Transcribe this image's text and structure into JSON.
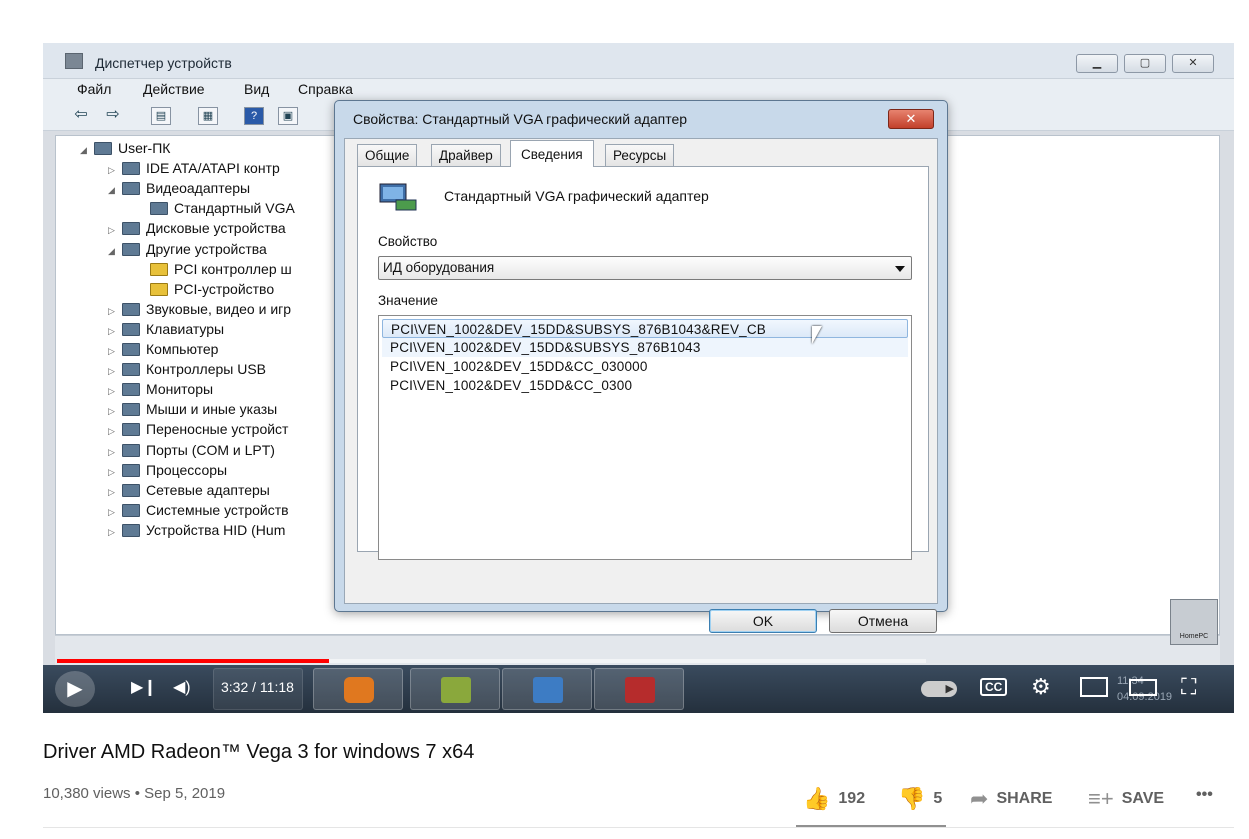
{
  "device_manager": {
    "title": "Диспетчер устройств",
    "menu": [
      "Файл",
      "Действие",
      "Вид",
      "Справка"
    ],
    "tree": [
      {
        "label": "User-ПК",
        "level": 0,
        "expanded": true,
        "icon": "computer-icon"
      },
      {
        "label": "IDE ATA/ATAPI контр",
        "level": 1,
        "expanded": false,
        "icon": "ide-controller-icon"
      },
      {
        "label": "Видеоадаптеры",
        "level": 1,
        "expanded": true,
        "icon": "display-adapter-icon"
      },
      {
        "label": "Стандартный VGA",
        "level": 2,
        "icon": "display-adapter-icon"
      },
      {
        "label": "Дисковые устройства",
        "level": 1,
        "expanded": false,
        "icon": "disk-icon"
      },
      {
        "label": "Другие устройства",
        "level": 1,
        "expanded": true,
        "icon": "unknown-device-icon"
      },
      {
        "label": "PCI контроллер ш",
        "level": 2,
        "icon": "warning-device-icon"
      },
      {
        "label": "PCI-устройство",
        "level": 2,
        "icon": "warning-device-icon"
      },
      {
        "label": "Звуковые, видео и игр",
        "level": 1,
        "expanded": false,
        "icon": "sound-icon"
      },
      {
        "label": "Клавиатуры",
        "level": 1,
        "expanded": false,
        "icon": "keyboard-icon"
      },
      {
        "label": "Компьютер",
        "level": 1,
        "expanded": false,
        "icon": "computer-icon"
      },
      {
        "label": "Контроллеры USB",
        "level": 1,
        "expanded": false,
        "icon": "usb-icon"
      },
      {
        "label": "Мониторы",
        "level": 1,
        "expanded": false,
        "icon": "monitor-icon"
      },
      {
        "label": "Мыши и иные указы",
        "level": 1,
        "expanded": false,
        "icon": "mouse-icon"
      },
      {
        "label": "Переносные устройст",
        "level": 1,
        "expanded": false,
        "icon": "portable-device-icon"
      },
      {
        "label": "Порты (COM и LPT)",
        "level": 1,
        "expanded": false,
        "icon": "port-icon"
      },
      {
        "label": "Процессоры",
        "level": 1,
        "expanded": false,
        "icon": "processor-icon"
      },
      {
        "label": "Сетевые адаптеры",
        "level": 1,
        "expanded": false,
        "icon": "network-icon"
      },
      {
        "label": "Системные устройств",
        "level": 1,
        "expanded": false,
        "icon": "system-device-icon"
      },
      {
        "label": "Устройства HID (Hum",
        "level": 1,
        "expanded": false,
        "icon": "hid-icon"
      }
    ]
  },
  "dialog": {
    "title": "Свойства: Стандартный VGA графический адаптер",
    "close_label": "✕",
    "tabs": [
      "Общие",
      "Драйвер",
      "Сведения",
      "Ресурсы"
    ],
    "active_tab": "Сведения",
    "device_name": "Стандартный VGA графический адаптер",
    "property_label": "Свойство",
    "property_value": "ИД оборудования",
    "value_label": "Значение",
    "values": [
      "PCI\\VEN_1002&DEV_15DD&SUBSYS_876B1043&REV_CB",
      "PCI\\VEN_1002&DEV_15DD&SUBSYS_876B1043",
      "PCI\\VEN_1002&DEV_15DD&CC_030000",
      "PCI\\VEN_1002&DEV_15DD&CC_0300"
    ],
    "ok_label": "OK",
    "cancel_label": "Отмена"
  },
  "watermark": "HomePC",
  "player": {
    "time": "3:32 / 11:18",
    "ghost_time": "11:34",
    "ghost_date": "04.09.2019",
    "progress_fraction": 0.313
  },
  "video": {
    "title": "Driver AMD Radeon™ Vega 3 for windows 7 x64",
    "views": "10,380 views",
    "date": "Sep 5, 2019",
    "likes": "192",
    "dislikes": "5",
    "share_label": "SHARE",
    "save_label": "SAVE",
    "more_label": "•••"
  },
  "colors": {
    "progress": "#ff0000",
    "dialog_frame": "#c8d9ea",
    "selection": "#dce9f8"
  }
}
